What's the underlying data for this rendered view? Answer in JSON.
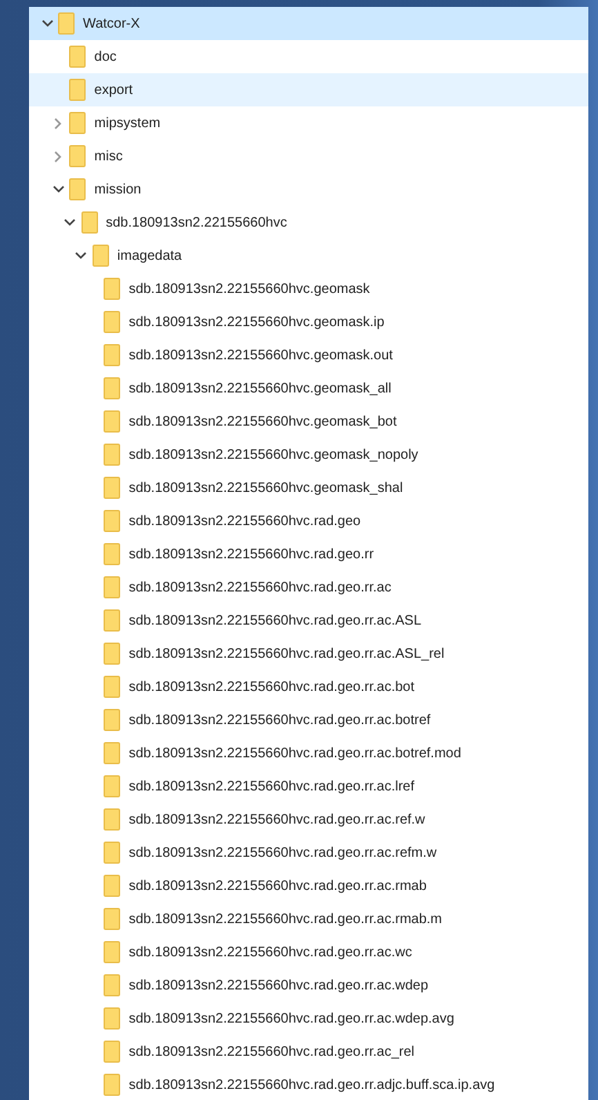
{
  "tree": [
    {
      "label": "Watcor-X",
      "expandable": true,
      "expanded": true,
      "selected": true,
      "hot": false,
      "children": [
        {
          "label": "doc",
          "expandable": false,
          "selected": false,
          "hot": false
        },
        {
          "label": "export",
          "expandable": false,
          "selected": false,
          "hot": true
        },
        {
          "label": "mipsystem",
          "expandable": true,
          "expanded": false,
          "selected": false,
          "hot": false
        },
        {
          "label": "misc",
          "expandable": true,
          "expanded": false,
          "selected": false,
          "hot": false
        },
        {
          "label": "mission",
          "expandable": true,
          "expanded": true,
          "selected": false,
          "hot": false,
          "children": [
            {
              "label": "sdb.180913sn2.22155660hvc",
              "expandable": true,
              "expanded": true,
              "selected": false,
              "hot": false,
              "children": [
                {
                  "label": "imagedata",
                  "expandable": true,
                  "expanded": true,
                  "selected": false,
                  "hot": false,
                  "children": [
                    {
                      "label": "sdb.180913sn2.22155660hvc.geomask",
                      "expandable": false,
                      "selected": false,
                      "hot": false
                    },
                    {
                      "label": "sdb.180913sn2.22155660hvc.geomask.ip",
                      "expandable": false,
                      "selected": false,
                      "hot": false
                    },
                    {
                      "label": "sdb.180913sn2.22155660hvc.geomask.out",
                      "expandable": false,
                      "selected": false,
                      "hot": false
                    },
                    {
                      "label": "sdb.180913sn2.22155660hvc.geomask_all",
                      "expandable": false,
                      "selected": false,
                      "hot": false
                    },
                    {
                      "label": "sdb.180913sn2.22155660hvc.geomask_bot",
                      "expandable": false,
                      "selected": false,
                      "hot": false
                    },
                    {
                      "label": "sdb.180913sn2.22155660hvc.geomask_nopoly",
                      "expandable": false,
                      "selected": false,
                      "hot": false
                    },
                    {
                      "label": "sdb.180913sn2.22155660hvc.geomask_shal",
                      "expandable": false,
                      "selected": false,
                      "hot": false
                    },
                    {
                      "label": "sdb.180913sn2.22155660hvc.rad.geo",
                      "expandable": false,
                      "selected": false,
                      "hot": false
                    },
                    {
                      "label": "sdb.180913sn2.22155660hvc.rad.geo.rr",
                      "expandable": false,
                      "selected": false,
                      "hot": false
                    },
                    {
                      "label": "sdb.180913sn2.22155660hvc.rad.geo.rr.ac",
                      "expandable": false,
                      "selected": false,
                      "hot": false
                    },
                    {
                      "label": "sdb.180913sn2.22155660hvc.rad.geo.rr.ac.ASL",
                      "expandable": false,
                      "selected": false,
                      "hot": false
                    },
                    {
                      "label": "sdb.180913sn2.22155660hvc.rad.geo.rr.ac.ASL_rel",
                      "expandable": false,
                      "selected": false,
                      "hot": false
                    },
                    {
                      "label": "sdb.180913sn2.22155660hvc.rad.geo.rr.ac.bot",
                      "expandable": false,
                      "selected": false,
                      "hot": false
                    },
                    {
                      "label": "sdb.180913sn2.22155660hvc.rad.geo.rr.ac.botref",
                      "expandable": false,
                      "selected": false,
                      "hot": false
                    },
                    {
                      "label": "sdb.180913sn2.22155660hvc.rad.geo.rr.ac.botref.mod",
                      "expandable": false,
                      "selected": false,
                      "hot": false
                    },
                    {
                      "label": "sdb.180913sn2.22155660hvc.rad.geo.rr.ac.lref",
                      "expandable": false,
                      "selected": false,
                      "hot": false
                    },
                    {
                      "label": "sdb.180913sn2.22155660hvc.rad.geo.rr.ac.ref.w",
                      "expandable": false,
                      "selected": false,
                      "hot": false
                    },
                    {
                      "label": "sdb.180913sn2.22155660hvc.rad.geo.rr.ac.refm.w",
                      "expandable": false,
                      "selected": false,
                      "hot": false
                    },
                    {
                      "label": "sdb.180913sn2.22155660hvc.rad.geo.rr.ac.rmab",
                      "expandable": false,
                      "selected": false,
                      "hot": false
                    },
                    {
                      "label": "sdb.180913sn2.22155660hvc.rad.geo.rr.ac.rmab.m",
                      "expandable": false,
                      "selected": false,
                      "hot": false
                    },
                    {
                      "label": "sdb.180913sn2.22155660hvc.rad.geo.rr.ac.wc",
                      "expandable": false,
                      "selected": false,
                      "hot": false
                    },
                    {
                      "label": "sdb.180913sn2.22155660hvc.rad.geo.rr.ac.wdep",
                      "expandable": false,
                      "selected": false,
                      "hot": false
                    },
                    {
                      "label": "sdb.180913sn2.22155660hvc.rad.geo.rr.ac.wdep.avg",
                      "expandable": false,
                      "selected": false,
                      "hot": false
                    },
                    {
                      "label": "sdb.180913sn2.22155660hvc.rad.geo.rr.ac_rel",
                      "expandable": false,
                      "selected": false,
                      "hot": false
                    },
                    {
                      "label": "sdb.180913sn2.22155660hvc.rad.geo.rr.adjc.buff.sca.ip.avg",
                      "expandable": false,
                      "selected": false,
                      "hot": false
                    }
                  ]
                }
              ]
            }
          ]
        }
      ]
    }
  ]
}
